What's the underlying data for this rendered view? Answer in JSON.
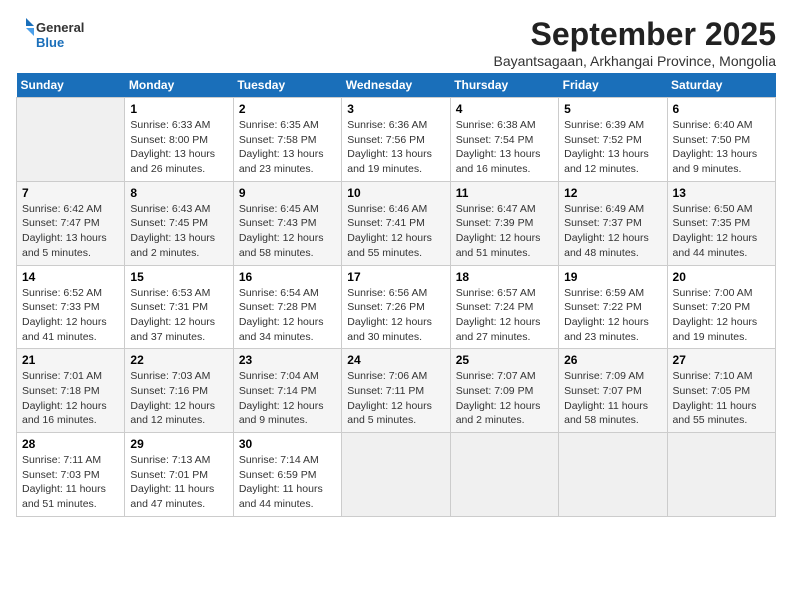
{
  "logo": {
    "general": "General",
    "blue": "Blue"
  },
  "title": "September 2025",
  "subtitle": "Bayantsagaan, Arkhangai Province, Mongolia",
  "weekdays": [
    "Sunday",
    "Monday",
    "Tuesday",
    "Wednesday",
    "Thursday",
    "Friday",
    "Saturday"
  ],
  "weeks": [
    [
      {
        "day": "",
        "empty": true
      },
      {
        "day": "1",
        "sunrise": "Sunrise: 6:33 AM",
        "sunset": "Sunset: 8:00 PM",
        "daylight": "Daylight: 13 hours and 26 minutes."
      },
      {
        "day": "2",
        "sunrise": "Sunrise: 6:35 AM",
        "sunset": "Sunset: 7:58 PM",
        "daylight": "Daylight: 13 hours and 23 minutes."
      },
      {
        "day": "3",
        "sunrise": "Sunrise: 6:36 AM",
        "sunset": "Sunset: 7:56 PM",
        "daylight": "Daylight: 13 hours and 19 minutes."
      },
      {
        "day": "4",
        "sunrise": "Sunrise: 6:38 AM",
        "sunset": "Sunset: 7:54 PM",
        "daylight": "Daylight: 13 hours and 16 minutes."
      },
      {
        "day": "5",
        "sunrise": "Sunrise: 6:39 AM",
        "sunset": "Sunset: 7:52 PM",
        "daylight": "Daylight: 13 hours and 12 minutes."
      },
      {
        "day": "6",
        "sunrise": "Sunrise: 6:40 AM",
        "sunset": "Sunset: 7:50 PM",
        "daylight": "Daylight: 13 hours and 9 minutes."
      }
    ],
    [
      {
        "day": "7",
        "sunrise": "Sunrise: 6:42 AM",
        "sunset": "Sunset: 7:47 PM",
        "daylight": "Daylight: 13 hours and 5 minutes."
      },
      {
        "day": "8",
        "sunrise": "Sunrise: 6:43 AM",
        "sunset": "Sunset: 7:45 PM",
        "daylight": "Daylight: 13 hours and 2 minutes."
      },
      {
        "day": "9",
        "sunrise": "Sunrise: 6:45 AM",
        "sunset": "Sunset: 7:43 PM",
        "daylight": "Daylight: 12 hours and 58 minutes."
      },
      {
        "day": "10",
        "sunrise": "Sunrise: 6:46 AM",
        "sunset": "Sunset: 7:41 PM",
        "daylight": "Daylight: 12 hours and 55 minutes."
      },
      {
        "day": "11",
        "sunrise": "Sunrise: 6:47 AM",
        "sunset": "Sunset: 7:39 PM",
        "daylight": "Daylight: 12 hours and 51 minutes."
      },
      {
        "day": "12",
        "sunrise": "Sunrise: 6:49 AM",
        "sunset": "Sunset: 7:37 PM",
        "daylight": "Daylight: 12 hours and 48 minutes."
      },
      {
        "day": "13",
        "sunrise": "Sunrise: 6:50 AM",
        "sunset": "Sunset: 7:35 PM",
        "daylight": "Daylight: 12 hours and 44 minutes."
      }
    ],
    [
      {
        "day": "14",
        "sunrise": "Sunrise: 6:52 AM",
        "sunset": "Sunset: 7:33 PM",
        "daylight": "Daylight: 12 hours and 41 minutes."
      },
      {
        "day": "15",
        "sunrise": "Sunrise: 6:53 AM",
        "sunset": "Sunset: 7:31 PM",
        "daylight": "Daylight: 12 hours and 37 minutes."
      },
      {
        "day": "16",
        "sunrise": "Sunrise: 6:54 AM",
        "sunset": "Sunset: 7:28 PM",
        "daylight": "Daylight: 12 hours and 34 minutes."
      },
      {
        "day": "17",
        "sunrise": "Sunrise: 6:56 AM",
        "sunset": "Sunset: 7:26 PM",
        "daylight": "Daylight: 12 hours and 30 minutes."
      },
      {
        "day": "18",
        "sunrise": "Sunrise: 6:57 AM",
        "sunset": "Sunset: 7:24 PM",
        "daylight": "Daylight: 12 hours and 27 minutes."
      },
      {
        "day": "19",
        "sunrise": "Sunrise: 6:59 AM",
        "sunset": "Sunset: 7:22 PM",
        "daylight": "Daylight: 12 hours and 23 minutes."
      },
      {
        "day": "20",
        "sunrise": "Sunrise: 7:00 AM",
        "sunset": "Sunset: 7:20 PM",
        "daylight": "Daylight: 12 hours and 19 minutes."
      }
    ],
    [
      {
        "day": "21",
        "sunrise": "Sunrise: 7:01 AM",
        "sunset": "Sunset: 7:18 PM",
        "daylight": "Daylight: 12 hours and 16 minutes."
      },
      {
        "day": "22",
        "sunrise": "Sunrise: 7:03 AM",
        "sunset": "Sunset: 7:16 PM",
        "daylight": "Daylight: 12 hours and 12 minutes."
      },
      {
        "day": "23",
        "sunrise": "Sunrise: 7:04 AM",
        "sunset": "Sunset: 7:14 PM",
        "daylight": "Daylight: 12 hours and 9 minutes."
      },
      {
        "day": "24",
        "sunrise": "Sunrise: 7:06 AM",
        "sunset": "Sunset: 7:11 PM",
        "daylight": "Daylight: 12 hours and 5 minutes."
      },
      {
        "day": "25",
        "sunrise": "Sunrise: 7:07 AM",
        "sunset": "Sunset: 7:09 PM",
        "daylight": "Daylight: 12 hours and 2 minutes."
      },
      {
        "day": "26",
        "sunrise": "Sunrise: 7:09 AM",
        "sunset": "Sunset: 7:07 PM",
        "daylight": "Daylight: 11 hours and 58 minutes."
      },
      {
        "day": "27",
        "sunrise": "Sunrise: 7:10 AM",
        "sunset": "Sunset: 7:05 PM",
        "daylight": "Daylight: 11 hours and 55 minutes."
      }
    ],
    [
      {
        "day": "28",
        "sunrise": "Sunrise: 7:11 AM",
        "sunset": "Sunset: 7:03 PM",
        "daylight": "Daylight: 11 hours and 51 minutes."
      },
      {
        "day": "29",
        "sunrise": "Sunrise: 7:13 AM",
        "sunset": "Sunset: 7:01 PM",
        "daylight": "Daylight: 11 hours and 47 minutes."
      },
      {
        "day": "30",
        "sunrise": "Sunrise: 7:14 AM",
        "sunset": "Sunset: 6:59 PM",
        "daylight": "Daylight: 11 hours and 44 minutes."
      },
      {
        "day": "",
        "empty": true
      },
      {
        "day": "",
        "empty": true
      },
      {
        "day": "",
        "empty": true
      },
      {
        "day": "",
        "empty": true
      }
    ]
  ]
}
